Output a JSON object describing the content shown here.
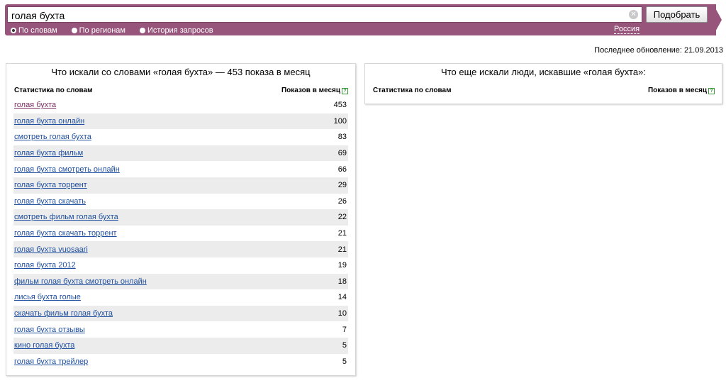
{
  "search": {
    "query": "голая бухта",
    "submit_label": "Подобрать",
    "modes": [
      {
        "label": "По словам",
        "selected": true
      },
      {
        "label": "По регионам",
        "selected": false
      },
      {
        "label": "История запросов",
        "selected": false
      }
    ],
    "region": "Россия"
  },
  "last_update": "Последнее обновление: 21.09.2013",
  "left_panel": {
    "title": "Что искали со словами «голая бухта» — 453 показа в месяц",
    "col_phrase": "Статистика по словам",
    "col_count": "Показов в месяц",
    "help_icon": "?",
    "rows": [
      {
        "phrase": "голая бухта",
        "count": "453"
      },
      {
        "phrase": "голая бухта онлайн",
        "count": "100"
      },
      {
        "phrase": "смотреть голая бухта",
        "count": "83"
      },
      {
        "phrase": "голая бухта фильм",
        "count": "69"
      },
      {
        "phrase": "голая бухта смотреть онлайн",
        "count": "66"
      },
      {
        "phrase": "голая бухта торрент",
        "count": "29"
      },
      {
        "phrase": "голая бухта скачать",
        "count": "26"
      },
      {
        "phrase": "смотреть фильм голая бухта",
        "count": "22"
      },
      {
        "phrase": "голая бухта скачать торрент",
        "count": "21"
      },
      {
        "phrase": "голая бухта vuosaari",
        "count": "21"
      },
      {
        "phrase": "голая бухта 2012",
        "count": "19"
      },
      {
        "phrase": "фильм голая бухта смотреть онлайн",
        "count": "18"
      },
      {
        "phrase": "лисья бухта голые",
        "count": "14"
      },
      {
        "phrase": "скачать фильм голая бухта",
        "count": "10"
      },
      {
        "phrase": "голая бухта отзывы",
        "count": "7"
      },
      {
        "phrase": "кино голая бухта",
        "count": "5"
      },
      {
        "phrase": "голая бухта трейлер",
        "count": "5"
      }
    ]
  },
  "right_panel": {
    "title": "Что еще искали люди, искавшие «голая бухта»:",
    "col_phrase": "Статистика по словам",
    "col_count": "Показов в месяц",
    "help_icon": "?"
  },
  "colors": {
    "brand_bar": "#98557c",
    "link": "#2050a0",
    "visited_link": "#7a2c63",
    "row_stripe": "#ececec"
  },
  "icons": [
    "clear-icon",
    "radio-icon",
    "help-icon"
  ]
}
